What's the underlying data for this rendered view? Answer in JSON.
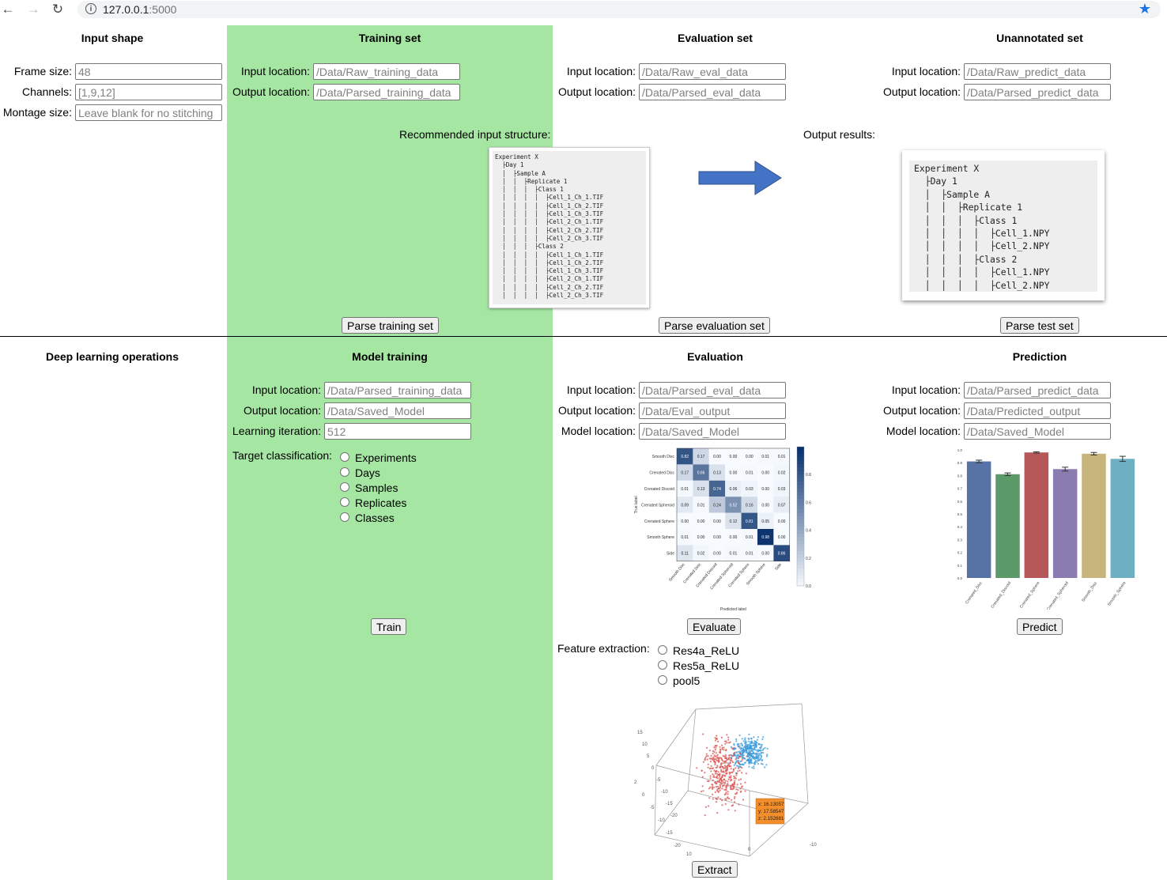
{
  "browser": {
    "host": "127.0.0.1",
    "port": ":5000"
  },
  "input_shape": {
    "title": "Input shape",
    "frame_size_label": "Frame size:",
    "frame_size_placeholder": "48",
    "channels_label": "Channels:",
    "channels_placeholder": "[1,9,12]",
    "montage_label": "Montage size:",
    "montage_placeholder": "Leave blank for no stitching"
  },
  "training_set": {
    "title": "Training set",
    "input_label": "Input location:",
    "input_placeholder": "/Data/Raw_training_data",
    "output_label": "Output location:",
    "output_placeholder": "/Data/Parsed_training_data",
    "button": "Parse training set"
  },
  "evaluation_set": {
    "title": "Evaluation set",
    "input_label": "Input location:",
    "input_placeholder": "/Data/Raw_eval_data",
    "output_label": "Output location:",
    "output_placeholder": "/Data/Parsed_eval_data",
    "button": "Parse evaluation set"
  },
  "unannotated_set": {
    "title": "Unannotated set",
    "input_label": "Input location:",
    "input_placeholder": "/Data/Raw_predict_data",
    "output_label": "Output location:",
    "output_placeholder": "/Data/Parsed_predict_data",
    "button": "Parse test set"
  },
  "structure": {
    "recommended_label": "Recommended input structure:",
    "output_label": "Output results:",
    "input_tree": "Experiment X\n  ├Day 1\n  │  ├Sample A\n  │  │  ├Replicate 1\n  │  │  │  ├Class 1\n  │  │  │  │  ├Cell_1_Ch_1.TIF\n  │  │  │  │  ├Cell_1_Ch_2.TIF\n  │  │  │  │  ├Cell_1_Ch_3.TIF\n  │  │  │  │  ├Cell_2_Ch_1.TIF\n  │  │  │  │  ├Cell_2_Ch_2.TIF\n  │  │  │  │  ├Cell_2_Ch_3.TIF\n  │  │  │  ├Class 2\n  │  │  │  │  ├Cell_1_Ch_1.TIF\n  │  │  │  │  ├Cell_1_Ch_2.TIF\n  │  │  │  │  ├Cell_1_Ch_3.TIF\n  │  │  │  │  ├Cell_2_Ch_1.TIF\n  │  │  │  │  ├Cell_2_Ch_2.TIF\n  │  │  │  │  ├Cell_2_Ch_3.TIF",
    "output_tree": "Experiment X\n  ├Day 1\n  │  ├Sample A\n  │  │  ├Replicate 1\n  │  │  │  ├Class 1\n  │  │  │  │  ├Cell_1.NPY\n  │  │  │  │  ├Cell_2.NPY\n  │  │  │  ├Class 2\n  │  │  │  │  ├Cell_1.NPY\n  │  │  │  │  ├Cell_2.NPY"
  },
  "dl_ops": {
    "title": "Deep learning operations"
  },
  "model_training": {
    "title": "Model training",
    "input_label": "Input location:",
    "input_placeholder": "/Data/Parsed_training_data",
    "output_label": "Output location:",
    "output_placeholder": "/Data/Saved_Model",
    "iter_label": "Learning iteration:",
    "iter_placeholder": "512",
    "target_label": "Target classification:",
    "options": [
      "Experiments",
      "Days",
      "Samples",
      "Replicates",
      "Classes"
    ],
    "button": "Train"
  },
  "evaluation": {
    "title": "Evaluation",
    "input_label": "Input location:",
    "input_placeholder": "/Data/Parsed_eval_data",
    "output_label": "Output location:",
    "output_placeholder": "/Data/Eval_output",
    "model_label": "Model location:",
    "model_placeholder": "/Data/Saved_Model",
    "button": "Evaluate",
    "feature_label": "Feature extraction:",
    "feature_options": [
      "Res4a_ReLU",
      "Res5a_ReLU",
      "pool5"
    ],
    "extract_button": "Extract"
  },
  "prediction": {
    "title": "Prediction",
    "input_label": "Input location:",
    "input_placeholder": "/Data/Parsed_predict_data",
    "output_label": "Output location:",
    "output_placeholder": "/Data/Predicted_output",
    "model_label": "Model location:",
    "model_placeholder": "/Data/Saved_Model",
    "button": "Predict"
  },
  "colors": {
    "green_column": "#a5e6a3",
    "arrow": "#4472c4",
    "bookmark_star": "#1a73e8"
  },
  "chart_data": [
    {
      "type": "heatmap",
      "title": "",
      "xlabel": "Predicted label",
      "ylabel": "True label",
      "rows": [
        "Smooth Disc",
        "Crenated Disc",
        "Crenated Discoid",
        "Crenated Spheroid",
        "Crenated Sphere",
        "Smooth Sphere",
        "Side"
      ],
      "cols": [
        "Smooth Disc",
        "Crenated Disc",
        "Crenated Discoid",
        "Crenated Spheroid",
        "Crenated Sphere",
        "Smooth Sphere",
        "Side"
      ],
      "values": [
        [
          0.82,
          0.17,
          0.0,
          0.0,
          0.0,
          0.01,
          0.01
        ],
        [
          0.17,
          0.66,
          0.13,
          0.0,
          0.01,
          0.0,
          0.02
        ],
        [
          0.01,
          0.13,
          0.74,
          0.06,
          0.03,
          0.0,
          0.03
        ],
        [
          0.09,
          0.01,
          0.24,
          0.52,
          0.16,
          0.0,
          0.07
        ],
        [
          0.0,
          0.0,
          0.0,
          0.12,
          0.81,
          0.05,
          0.0
        ],
        [
          0.01,
          0.0,
          0.0,
          0.0,
          0.01,
          0.98,
          0.0
        ],
        [
          0.11,
          0.02,
          0.0,
          0.01,
          0.01,
          0.0,
          0.86
        ]
      ],
      "colorbar_ticks": [
        "0.0",
        "0.2",
        "0.4",
        "0.6",
        "0.8"
      ]
    },
    {
      "type": "bar",
      "categories": [
        "Crenated_Disc",
        "Crenated_Discoid",
        "Crenated_Sphere",
        "Crenated_Spheroid",
        "Smooth_Disc",
        "Smooth_Sphere"
      ],
      "values": [
        0.91,
        0.81,
        0.98,
        0.85,
        0.97,
        0.93
      ],
      "errors": [
        0.01,
        0.01,
        0.005,
        0.015,
        0.01,
        0.02
      ],
      "colors": [
        "#5773a6",
        "#5c9a6a",
        "#b65859",
        "#8a7bb0",
        "#c8b57e",
        "#6fafc3"
      ],
      "ylim": [
        0,
        1.0
      ],
      "yticks": [
        "0.0",
        "0.1",
        "0.2",
        "0.3",
        "0.4",
        "0.5",
        "0.6",
        "0.7",
        "0.8",
        "0.9",
        "1.0"
      ]
    },
    {
      "type": "scatter",
      "dimensions": 3,
      "series_colors": [
        "#d9534f",
        "#3a9ad9"
      ],
      "z_ticks": [
        "15",
        "10",
        "5",
        "0",
        "-5",
        "-10",
        "-15",
        "-20"
      ],
      "x_ticks": [
        "2",
        "0",
        "-5",
        "-10",
        "-15",
        "-20"
      ],
      "y_ticks": [
        "10",
        "0",
        "-10"
      ],
      "hover_label": [
        "x: 16.13057",
        "y: 17.58547",
        "z: 2.152681"
      ]
    }
  ]
}
